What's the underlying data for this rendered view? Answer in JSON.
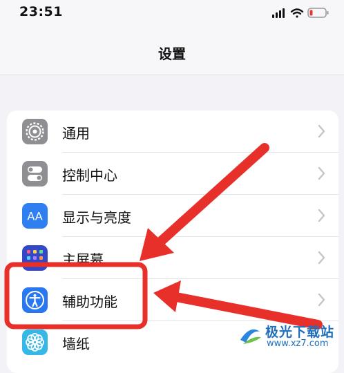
{
  "status_bar": {
    "time": "23:51"
  },
  "nav": {
    "title": "设置"
  },
  "settings": [
    {
      "label": "通用",
      "icon": "gear-icon"
    },
    {
      "label": "控制中心",
      "icon": "toggles-icon"
    },
    {
      "label": "显示与亮度",
      "icon": "display-aa-icon",
      "icon_text": "AA"
    },
    {
      "label": "主屏幕",
      "icon": "home-screen-grid-icon"
    },
    {
      "label": "辅助功能",
      "icon": "accessibility-icon"
    },
    {
      "label": "墙纸",
      "icon": "wallpaper-flower-icon"
    }
  ],
  "annotation": {
    "highlight_target": "辅助功能",
    "highlight_color": "#e8302a",
    "arrow_color": "#e8302a"
  },
  "watermark": {
    "name": "极光下载站",
    "url": "www.xz7.com"
  },
  "colors": {
    "general_icon": "#8e8e93",
    "control_center_icon": "#8e8e93",
    "display_icon": "#2f7ff0",
    "home_screen_icon": "#3348c8",
    "accessibility_icon": "#2a78f0",
    "wallpaper_icon": "#35b7e8"
  }
}
